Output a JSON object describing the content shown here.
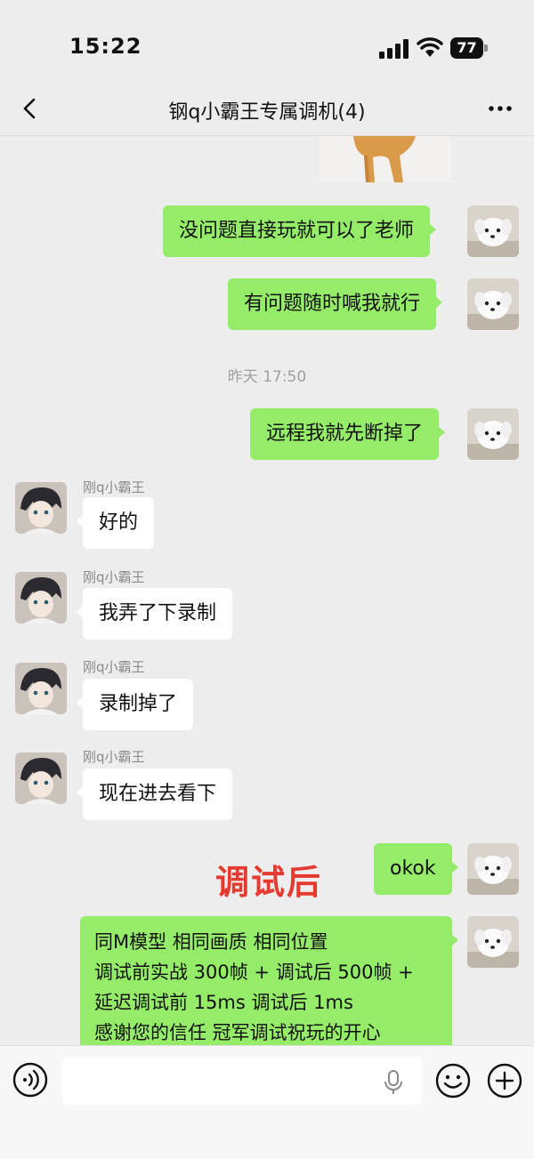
{
  "status_bar": {
    "time": "15:22",
    "battery": "77"
  },
  "nav": {
    "title": "钢q小霸王专属调机(4)"
  },
  "messages": {
    "m1": "没问题直接玩就可以了老师",
    "m2": "有问题随时喊我就行",
    "timestamp": "昨天 17:50",
    "m3": "远程我就先断掉了",
    "sender": "刚q小霸王",
    "o1": "好的",
    "o2": "我弄了下录制",
    "o3": "录制掉了",
    "o4": "现在进去看下",
    "m4": "okok",
    "m5_lines": [
      "同M模型 相同画质 相同位置",
      "调试前实战 300帧 + 调试后 500帧 +",
      "延迟调试前 15ms 调试后 1ms",
      "感谢您的信任 冠军调试祝玩的开心"
    ]
  },
  "overlay": {
    "text": "调试后"
  },
  "input_bar": {
    "placeholder": ""
  },
  "icons": {
    "back": "chevron-left-icon",
    "more": "more-icon",
    "voice": "voice-icon",
    "mic": "mic-icon",
    "emoji": "emoji-icon",
    "plus": "plus-icon"
  },
  "colors": {
    "my_bubble": "#95ec69",
    "other_bubble": "#ffffff",
    "background": "#ededed",
    "overlay_red": "#e53a2f"
  }
}
